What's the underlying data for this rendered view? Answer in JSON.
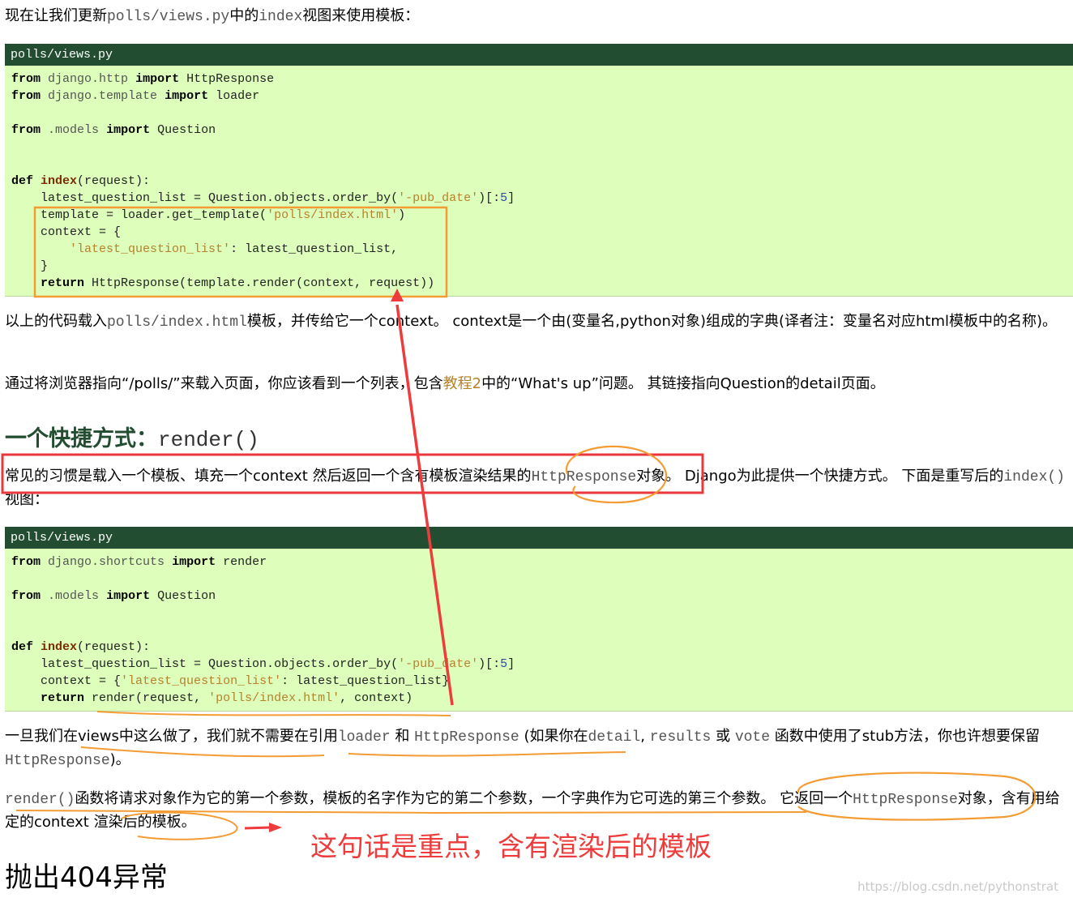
{
  "intro": {
    "part1": "现在让我们更新",
    "code1": "polls/views.py",
    "part2": "中的",
    "code2": "index",
    "part3": "视图来使用模板："
  },
  "code_block_1": {
    "filename": "polls/views.py",
    "lines": {
      "l1": {
        "kw": "from",
        "mod": "django.http",
        "kw2": "import",
        "rest": "HttpResponse"
      },
      "l2": {
        "kw": "from",
        "mod": "django.template",
        "kw2": "import",
        "rest": "loader"
      },
      "l3": {
        "kw": "from",
        "mod": ".models",
        "kw2": "import",
        "rest": "Question"
      },
      "l4": {
        "kw": "def",
        "fn": "index",
        "rest": "(request):"
      },
      "l5": {
        "a": "latest_question_list = Question.objects.order_by(",
        "str": "'-pub_date'",
        "b": ")[:",
        "num": "5",
        "c": "]"
      },
      "l6": {
        "a": "template = loader.get_template(",
        "str": "'polls/index.html'",
        "b": ")"
      },
      "l7": {
        "a": "context = {"
      },
      "l8": {
        "str": "'latest_question_list'",
        "b": ": latest_question_list,"
      },
      "l9": {
        "a": "}"
      },
      "l10": {
        "kw": "return",
        "rest": "HttpResponse(template.render(context, request))"
      }
    }
  },
  "para1": {
    "part1": "以上的代码载入",
    "code1": "polls/index.html",
    "part2": "模板，并传给它一个context。 context是一个由(变量名,python对象)组成的字典(译者注：变量名对应html模板中的名称)。"
  },
  "para2": {
    "part1": "通过将浏览器指向“/polls/”来载入页面，你应该看到一个列表，包含",
    "link": "教程2",
    "part2": "中的“What's up”问题。 其链接指向Question的detail页面。"
  },
  "heading": {
    "text": "一个快捷方式：",
    "code": "render()"
  },
  "para3": {
    "part1": "常见的习惯是载入一个模板、填充一个context 然后返回一个含有模板渲染结果的",
    "code1": "HttpResponse",
    "part2": "对象。 Django为此提供一个快捷方式。 下面是重写后的",
    "code2": "index()",
    "part3": "视图："
  },
  "code_block_2": {
    "filename": "polls/views.py",
    "lines": {
      "l1": {
        "kw": "from",
        "mod": "django.shortcuts",
        "kw2": "import",
        "rest": "render"
      },
      "l2": {
        "kw": "from",
        "mod": ".models",
        "kw2": "import",
        "rest": "Question"
      },
      "l3": {
        "kw": "def",
        "fn": "index",
        "rest": "(request):"
      },
      "l4": {
        "a": "latest_question_list = Question.objects.order_by(",
        "str": "'-pub_date'",
        "b": ")[:",
        "num": "5",
        "c": "]"
      },
      "l5": {
        "a": "context = {",
        "str": "'latest_question_list'",
        "b": ": latest_question_list}"
      },
      "l6": {
        "kw": "return",
        "a": "render(request, ",
        "str": "'polls/index.html'",
        "b": ", context)"
      }
    }
  },
  "para4": {
    "part1": "一旦我们在views中这么做了，我们就不需要在引用",
    "code1": "loader",
    "part2": " 和 ",
    "code2": "HttpResponse",
    "part3": " (如果你在",
    "code3": "detail",
    "part4": ", ",
    "code4": "results",
    "part5": " 或 ",
    "code5": "vote",
    "part6": " 函数中使用了stub方法，你也许想要保留",
    "code6": "HttpResponse",
    "part7": ")。"
  },
  "para5": {
    "code1": "render()",
    "part1": "函数将请求对象作为它的第一个参数，模板的名字作为它的第二个参数，一个字典作为它可选的第三个参数。 它返回一个",
    "code2": "HttpResponse",
    "part2": "对象，含有用给定的context 渲染后的模板。"
  },
  "annotation": {
    "text": "这句话是重点，含有渲染后的模板",
    "color": "#ee3b3b"
  },
  "heading2": {
    "text": "抛出404异常"
  },
  "watermark": {
    "text": "https://blog.csdn.net/pythonstrat"
  },
  "colors": {
    "code_header": "#234d31",
    "code_bg": "#ddffbb",
    "highlight_orange": "#f39c34",
    "highlight_red": "#e8373d"
  }
}
